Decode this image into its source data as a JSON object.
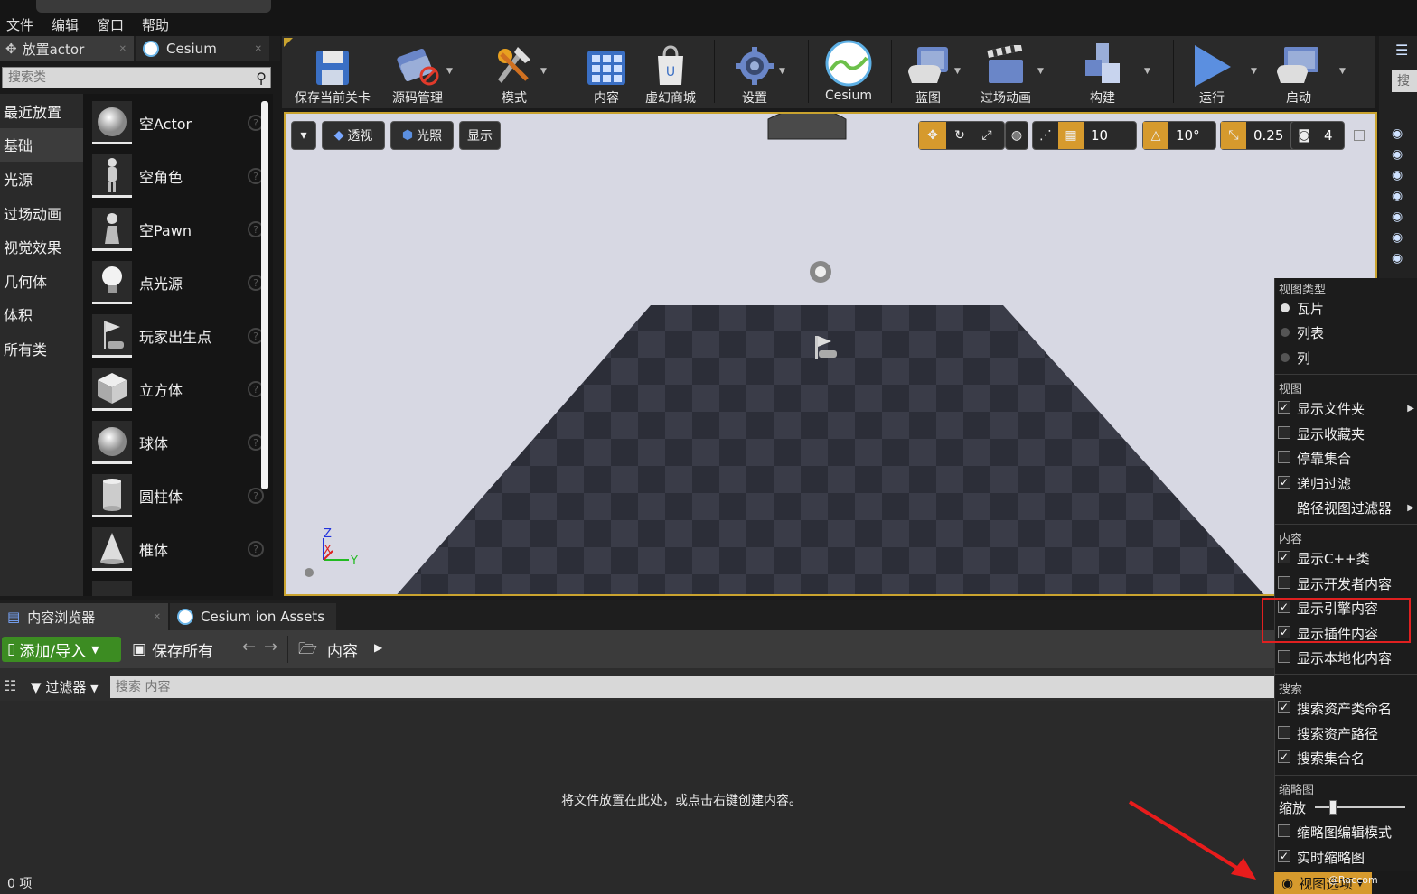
{
  "menubar": [
    "文件",
    "编辑",
    "窗口",
    "帮助"
  ],
  "place_panel": {
    "tabs": [
      "放置actor",
      "Cesium"
    ],
    "search_placeholder": "搜索类",
    "categories": [
      "最近放置",
      "基础",
      "光源",
      "过场动画",
      "视觉效果",
      "几何体",
      "体积",
      "所有类"
    ],
    "items": [
      "空Actor",
      "空角色",
      "空Pawn",
      "点光源",
      "玩家出生点",
      "立方体",
      "球体",
      "圆柱体",
      "椎体"
    ]
  },
  "toolbar": [
    "保存当前关卡",
    "源码管理",
    "模式",
    "内容",
    "虚幻商城",
    "设置",
    "Cesium",
    "蓝图",
    "过场动画",
    "构建",
    "运行",
    "启动"
  ],
  "viewport": {
    "perspective": "透视",
    "lighting": "光照",
    "show": "显示",
    "grid_snap": "10",
    "rot_snap": "10°",
    "scale_snap": "0.25",
    "cam_speed": "4",
    "axis_z": "Z",
    "axis_x": "X",
    "axis_y": "Y"
  },
  "right_strip": {
    "search": "搜索"
  },
  "content_browser": {
    "tabs": [
      "内容浏览器",
      "Cesium ion Assets"
    ],
    "add_import": "添加/导入",
    "save_all": "保存所有",
    "path": "内容",
    "filters": "过滤器",
    "search_placeholder": "搜索 内容",
    "drop_hint": "将文件放置在此处，或点击右键创建内容。",
    "item_count": "0 项"
  },
  "view_menu": {
    "sec_type": "视图类型",
    "type_items": [
      "瓦片",
      "列表",
      "列"
    ],
    "sec_view": "视图",
    "view_items": [
      "显示文件夹",
      "显示收藏夹",
      "停靠集合",
      "递归过滤",
      "路径视图过滤器"
    ],
    "sec_content": "内容",
    "content_items": [
      "显示C++类",
      "显示开发者内容",
      "显示引擎内容",
      "显示插件内容",
      "显示本地化内容"
    ],
    "sec_search": "搜索",
    "search_items": [
      "搜索资产类命名",
      "搜索资产路径",
      "搜索集合名"
    ],
    "sec_thumb": "缩略图",
    "zoom": "缩放",
    "thumb_items": [
      "缩略图编辑模式",
      "实时缩略图"
    ],
    "view_options": "视图选项",
    "watermark": "@Raccom"
  },
  "colors": {
    "accent": "#d69a2d",
    "add_button": "#3c8c22",
    "highlight": "#e02020"
  }
}
